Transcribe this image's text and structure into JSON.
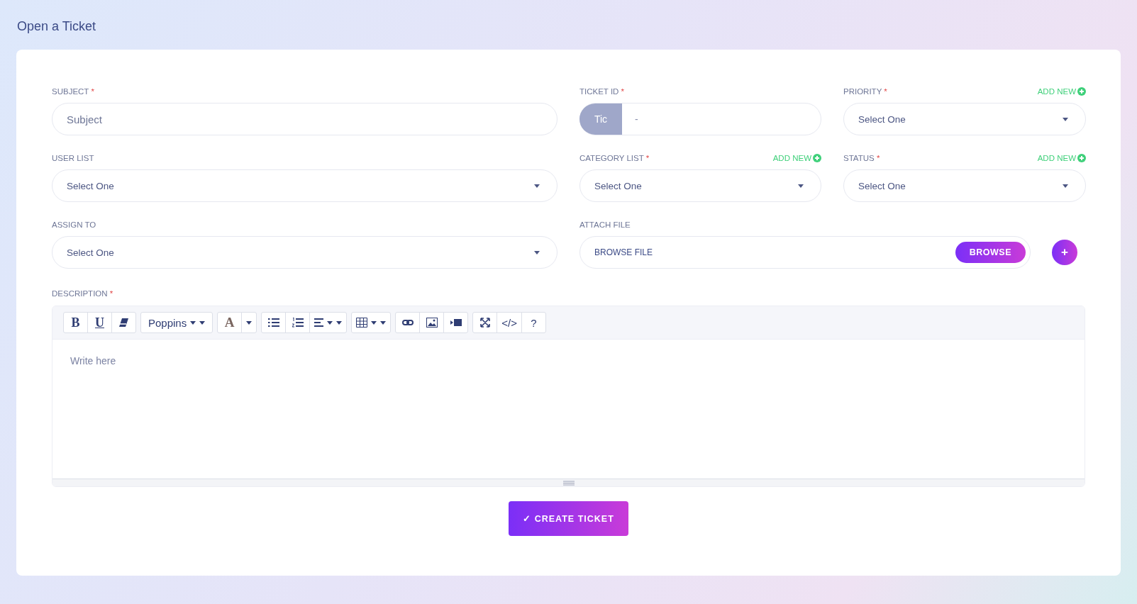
{
  "page_title": "Open a Ticket",
  "rows": [
    [
      {
        "kind": "text",
        "label": "SUBJECT",
        "required_mark": "*",
        "placeholder": "Subject"
      },
      {
        "kind": "ticket",
        "label": "TICKET ID",
        "required_mark": "*",
        "prefix": "Tic",
        "value": "-"
      },
      {
        "kind": "select",
        "label": "PRIORITY",
        "required_mark": "*",
        "add_new": "ADD NEW",
        "value": "Select One"
      }
    ],
    [
      {
        "kind": "select",
        "label": "USER LIST",
        "value": "Select One"
      },
      {
        "kind": "select",
        "label": "CATEGORY LIST",
        "required_mark": "*",
        "add_new": "ADD NEW",
        "value": "Select One"
      },
      {
        "kind": "select",
        "label": "STATUS",
        "required_mark": "*",
        "add_new": "ADD NEW",
        "value": "Select One"
      }
    ],
    [
      {
        "kind": "select",
        "label": "ASSIGN TO",
        "value": "Select One"
      },
      {
        "kind": "file",
        "label": "ATTACH FILE",
        "placeholder": "BROWSE FILE",
        "button": "BROWSE",
        "add_button": "+"
      }
    ]
  ],
  "description": {
    "label": "DESCRIPTION",
    "required_mark": "*",
    "placeholder": "Write here",
    "toolbar": [
      [
        {
          "kind": "bold",
          "label": "B"
        },
        {
          "kind": "underline",
          "label": "U"
        },
        {
          "kind": "eraser"
        }
      ],
      [
        {
          "kind": "font",
          "label": "Poppins"
        }
      ],
      [
        {
          "kind": "color",
          "label": "A"
        },
        {
          "kind": "caret"
        }
      ],
      [
        {
          "kind": "ul"
        },
        {
          "kind": "ol"
        },
        {
          "kind": "align"
        }
      ],
      [
        {
          "kind": "table"
        }
      ],
      [
        {
          "kind": "link"
        },
        {
          "kind": "image"
        },
        {
          "kind": "video"
        }
      ],
      [
        {
          "kind": "fullscreen"
        },
        {
          "kind": "code",
          "label": "</>"
        },
        {
          "kind": "help",
          "label": "?"
        }
      ]
    ]
  },
  "submit": {
    "icon": "✓",
    "label": "CREATE TICKET"
  }
}
